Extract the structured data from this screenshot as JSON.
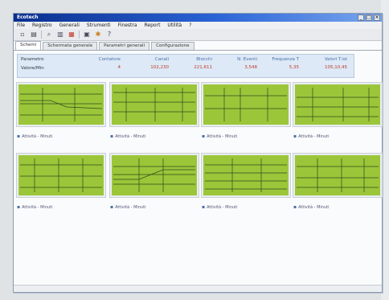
{
  "window": {
    "title": "Ecotech",
    "buttons": [
      "_",
      "□",
      "×"
    ]
  },
  "menu": [
    "File",
    "Registro",
    "Generali",
    "Strumenti",
    "Finestra",
    "Report",
    "Utilità",
    "?"
  ],
  "toolbar_icons": [
    "new-icon",
    "open-icon",
    "search-icon",
    "print-icon",
    "chart-icon",
    "table-icon",
    "settings-icon",
    "help-icon"
  ],
  "tabs": [
    "Schemi",
    "Schermata generale",
    "Parametri generali",
    "Configurazione"
  ],
  "stats": {
    "row_labels": [
      "Parametro",
      "Valore/Min"
    ],
    "columns": [
      {
        "header": "Contatore",
        "value": "4"
      },
      {
        "header": "Canali",
        "value": "102,230"
      },
      {
        "header": "Blocchi",
        "value": "221,611"
      },
      {
        "header": "N. Eventi",
        "value": "3,548"
      },
      {
        "header": "Frequenza T",
        "value": "5,35"
      },
      {
        "header": "Valori T.ist",
        "value": "105,10,45"
      }
    ]
  },
  "cards": [
    {
      "caption": "Attività - Minuti"
    },
    {
      "caption": "Attività - Minuti"
    },
    {
      "caption": "Attività - Minuti"
    },
    {
      "caption": "Attività - Minuti"
    },
    {
      "caption": "Attività - Minuti"
    },
    {
      "caption": "Attività - Minuti"
    },
    {
      "caption": "Attività - Minuti"
    },
    {
      "caption": "Attività - Minuti"
    }
  ],
  "colors": {
    "chart_fill": "#9bc63a",
    "chart_line": "#2f4a1a",
    "title_bar": "#0a2f8e",
    "accent_value": "#c0392b"
  }
}
